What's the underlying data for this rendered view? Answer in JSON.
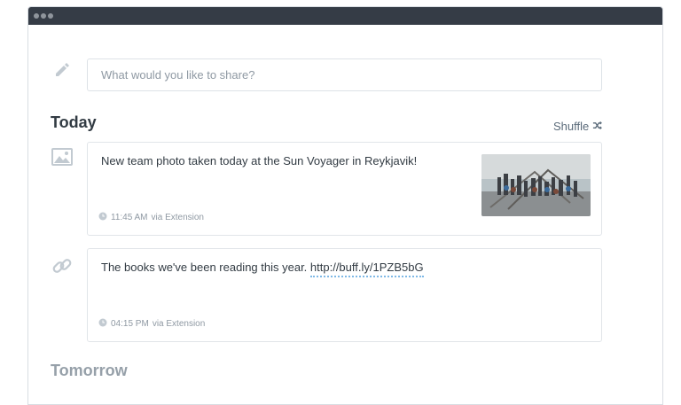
{
  "composer": {
    "placeholder": "What would you like to share?"
  },
  "today": {
    "heading": "Today",
    "shuffle_label": "Shuffle",
    "posts": [
      {
        "text": "New team photo taken today at the Sun Voyager in Reykjavik!",
        "time": "11:45 AM",
        "via": "via Extension",
        "has_image": true
      },
      {
        "text": "The books we've been reading this year. ",
        "link": "http://buff.ly/1PZB5bG",
        "time": "04:15 PM",
        "via": "via Extension"
      }
    ]
  },
  "tomorrow": {
    "heading": "Tomorrow"
  },
  "icons": [
    "pencil-icon",
    "image-icon",
    "link-icon",
    "shuffle-icon",
    "clock-icon"
  ],
  "colors": {
    "titlebar": "#353c46",
    "link_underline": "#7fb9e6",
    "muted_text": "#8f99a3"
  }
}
